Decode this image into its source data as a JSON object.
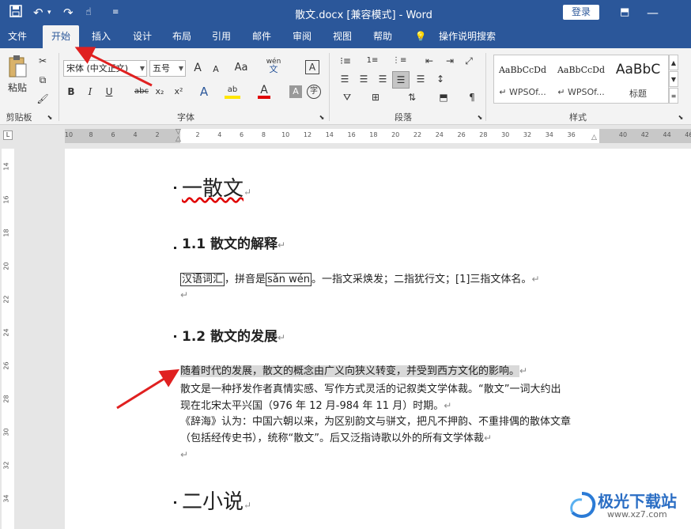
{
  "titlebar": {
    "title": "散文.docx [兼容模式] - Word",
    "login_label": "登录"
  },
  "tabs": [
    {
      "label": "文件"
    },
    {
      "label": "开始"
    },
    {
      "label": "插入"
    },
    {
      "label": "设计"
    },
    {
      "label": "布局"
    },
    {
      "label": "引用"
    },
    {
      "label": "邮件"
    },
    {
      "label": "审阅"
    },
    {
      "label": "视图"
    },
    {
      "label": "帮助"
    },
    {
      "label": "操作说明搜索"
    }
  ],
  "ribbon": {
    "paste_label": "粘贴",
    "clipboard_label": "剪贴板",
    "font_name": "宋体 (中文正文)",
    "font_size": "五号",
    "font_group_label": "字体",
    "paragraph_group_label": "段落",
    "styles_group_label": "样式",
    "styles": [
      {
        "preview": "AaBbCcDd",
        "name": "↵ WPSOf..."
      },
      {
        "preview": "AaBbCcDd",
        "name": "↵ WPSOf..."
      },
      {
        "preview": "AaBbC",
        "name": "标题"
      }
    ],
    "grow_font": "A",
    "shrink_font": "A",
    "change_case": "Aa",
    "phonetic": "wén",
    "phonetic_char": "文",
    "border_char": "A",
    "bold": "B",
    "italic": "I",
    "underline": "U",
    "strike": "abc",
    "subscript": "x₂",
    "superscript": "x²",
    "highlight_text": "ab",
    "font_color": "A",
    "shading": "A",
    "enclose": "字"
  },
  "ruler": {
    "h_numbers": [
      "10",
      "8",
      "6",
      "4",
      "2",
      "2",
      "4",
      "6",
      "8",
      "10",
      "12",
      "14",
      "16",
      "18",
      "20",
      "22",
      "24",
      "26",
      "28",
      "30",
      "32",
      "34",
      "36",
      "40",
      "42",
      "44",
      "46",
      "48"
    ],
    "v_numbers": [
      "14",
      "16",
      "18",
      "20",
      "22",
      "24",
      "26",
      "28",
      "30",
      "32",
      "34"
    ]
  },
  "document": {
    "h1_a": "一散文",
    "h2_a": "1.1 散文的解释",
    "p1_boxed1": "汉语词汇",
    "p1_mid": "，拼音是",
    "p1_boxed2": "sǎn wén",
    "p1_rest": "。一指文采焕发；二指犹行文；[1]三指文体名。",
    "h2_b": "1.2 散文的发展",
    "p2_line1": "随着时代的发展，散文的概念由广义向狭义转变，并受到西方文化的影响。",
    "p2_line2": "散文是一种抒发作者真情实感、写作方式灵活的记叙类文学体裁。“散文”一词大约出",
    "p2_line3": "现在北宋太平兴国（976 年 12 月-984 年 11 月）时期。",
    "p2_line4": "《辞海》认为：中国六朝以来，为区别韵文与骈文，把凡不押韵、不重排偶的散体文章",
    "p2_line5": "（包括经传史书），统称“散文”。后又泛指诗歌以外的所有文学体裁",
    "h1_b": "二小说",
    "para_mark": "↵"
  },
  "watermark": {
    "text": "极光下载站",
    "url": "www.xz7.com"
  },
  "colors": {
    "word_blue": "#2b579a",
    "annotation_red": "#e02020"
  }
}
